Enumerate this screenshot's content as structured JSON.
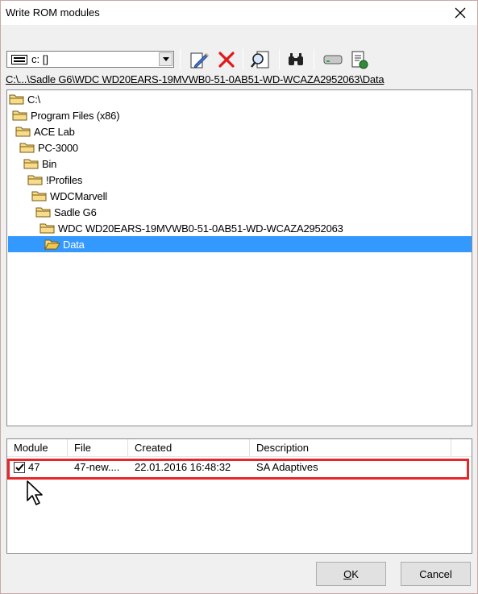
{
  "window": {
    "title": "Write ROM modules"
  },
  "toolbar": {
    "drive_label": "c: []",
    "icons": [
      "edit-pencil-icon",
      "delete-x-icon",
      "search-doc-icon",
      "binoculars-icon",
      "drive-icon",
      "properties-doc-icon"
    ]
  },
  "path": {
    "label": "C:\\...\\Sadle G6\\WDC WD20EARS-19MVWB0-51-0AB51-WD-WCAZA2952063\\Data"
  },
  "tree": {
    "items": [
      {
        "label": "C:\\"
      },
      {
        "label": "Program Files (x86)"
      },
      {
        "label": "ACE Lab"
      },
      {
        "label": "PC-3000"
      },
      {
        "label": "Bin"
      },
      {
        "label": "!Profiles"
      },
      {
        "label": "WDCMarvell"
      },
      {
        "label": "Sadle G6"
      },
      {
        "label": "WDC WD20EARS-19MVWB0-51-0AB51-WD-WCAZA2952063"
      },
      {
        "label": "Data"
      }
    ],
    "selected_index": 9
  },
  "list": {
    "columns": [
      "Module",
      "File",
      "Created",
      "Description"
    ],
    "rows": [
      {
        "module": "47",
        "file": "47-new....",
        "created": "22.01.2016 16:48:32",
        "description": "SA Adaptives",
        "checked": true
      }
    ]
  },
  "buttons": {
    "ok_prefix": "O",
    "ok_rest": "K",
    "cancel": "Cancel"
  },
  "colors": {
    "selection": "#3399ff",
    "highlight": "#e8262a"
  }
}
